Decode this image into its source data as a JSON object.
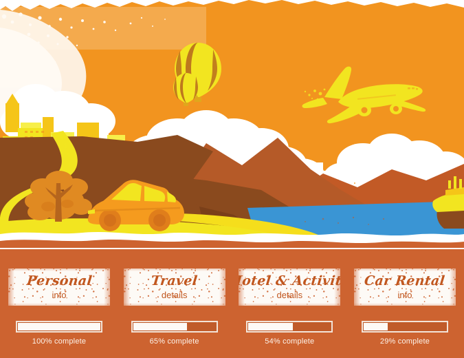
{
  "palette": {
    "sky_orange": "#F2941F",
    "footer_orange": "#CD6330",
    "yellow": "#F2E520",
    "gold": "#F5C518",
    "dark_brown": "#8A4A1E",
    "mid_brown": "#9C5426",
    "rust": "#B55A28",
    "water_blue": "#3A95D4",
    "paper_white": "#FDFAF6",
    "car_orange": "#F59B1E",
    "text_rust": "#C1571F"
  },
  "illustration": {
    "name": "travel-landscape-illustration",
    "elements": [
      "city-skyline",
      "hot-air-balloon-large",
      "hot-air-balloon-small",
      "airplane",
      "clouds",
      "mountains",
      "winding-road",
      "car",
      "tree",
      "lake",
      "cruise-ship"
    ]
  },
  "footer": {
    "cards": [
      {
        "id": "personal",
        "title": "Personal",
        "subtitle": "info",
        "progress": 100,
        "progress_label": "100% complete"
      },
      {
        "id": "travel",
        "title": "Travel",
        "subtitle": "details",
        "progress": 65,
        "progress_label": "65% complete"
      },
      {
        "id": "hotel-activity",
        "title": "Hotel & Activity",
        "subtitle": "details",
        "progress": 54,
        "progress_label": "54% complete"
      },
      {
        "id": "car-rental",
        "title": "Car Rental",
        "subtitle": "info",
        "progress": 29,
        "progress_label": "29% complete"
      }
    ]
  }
}
